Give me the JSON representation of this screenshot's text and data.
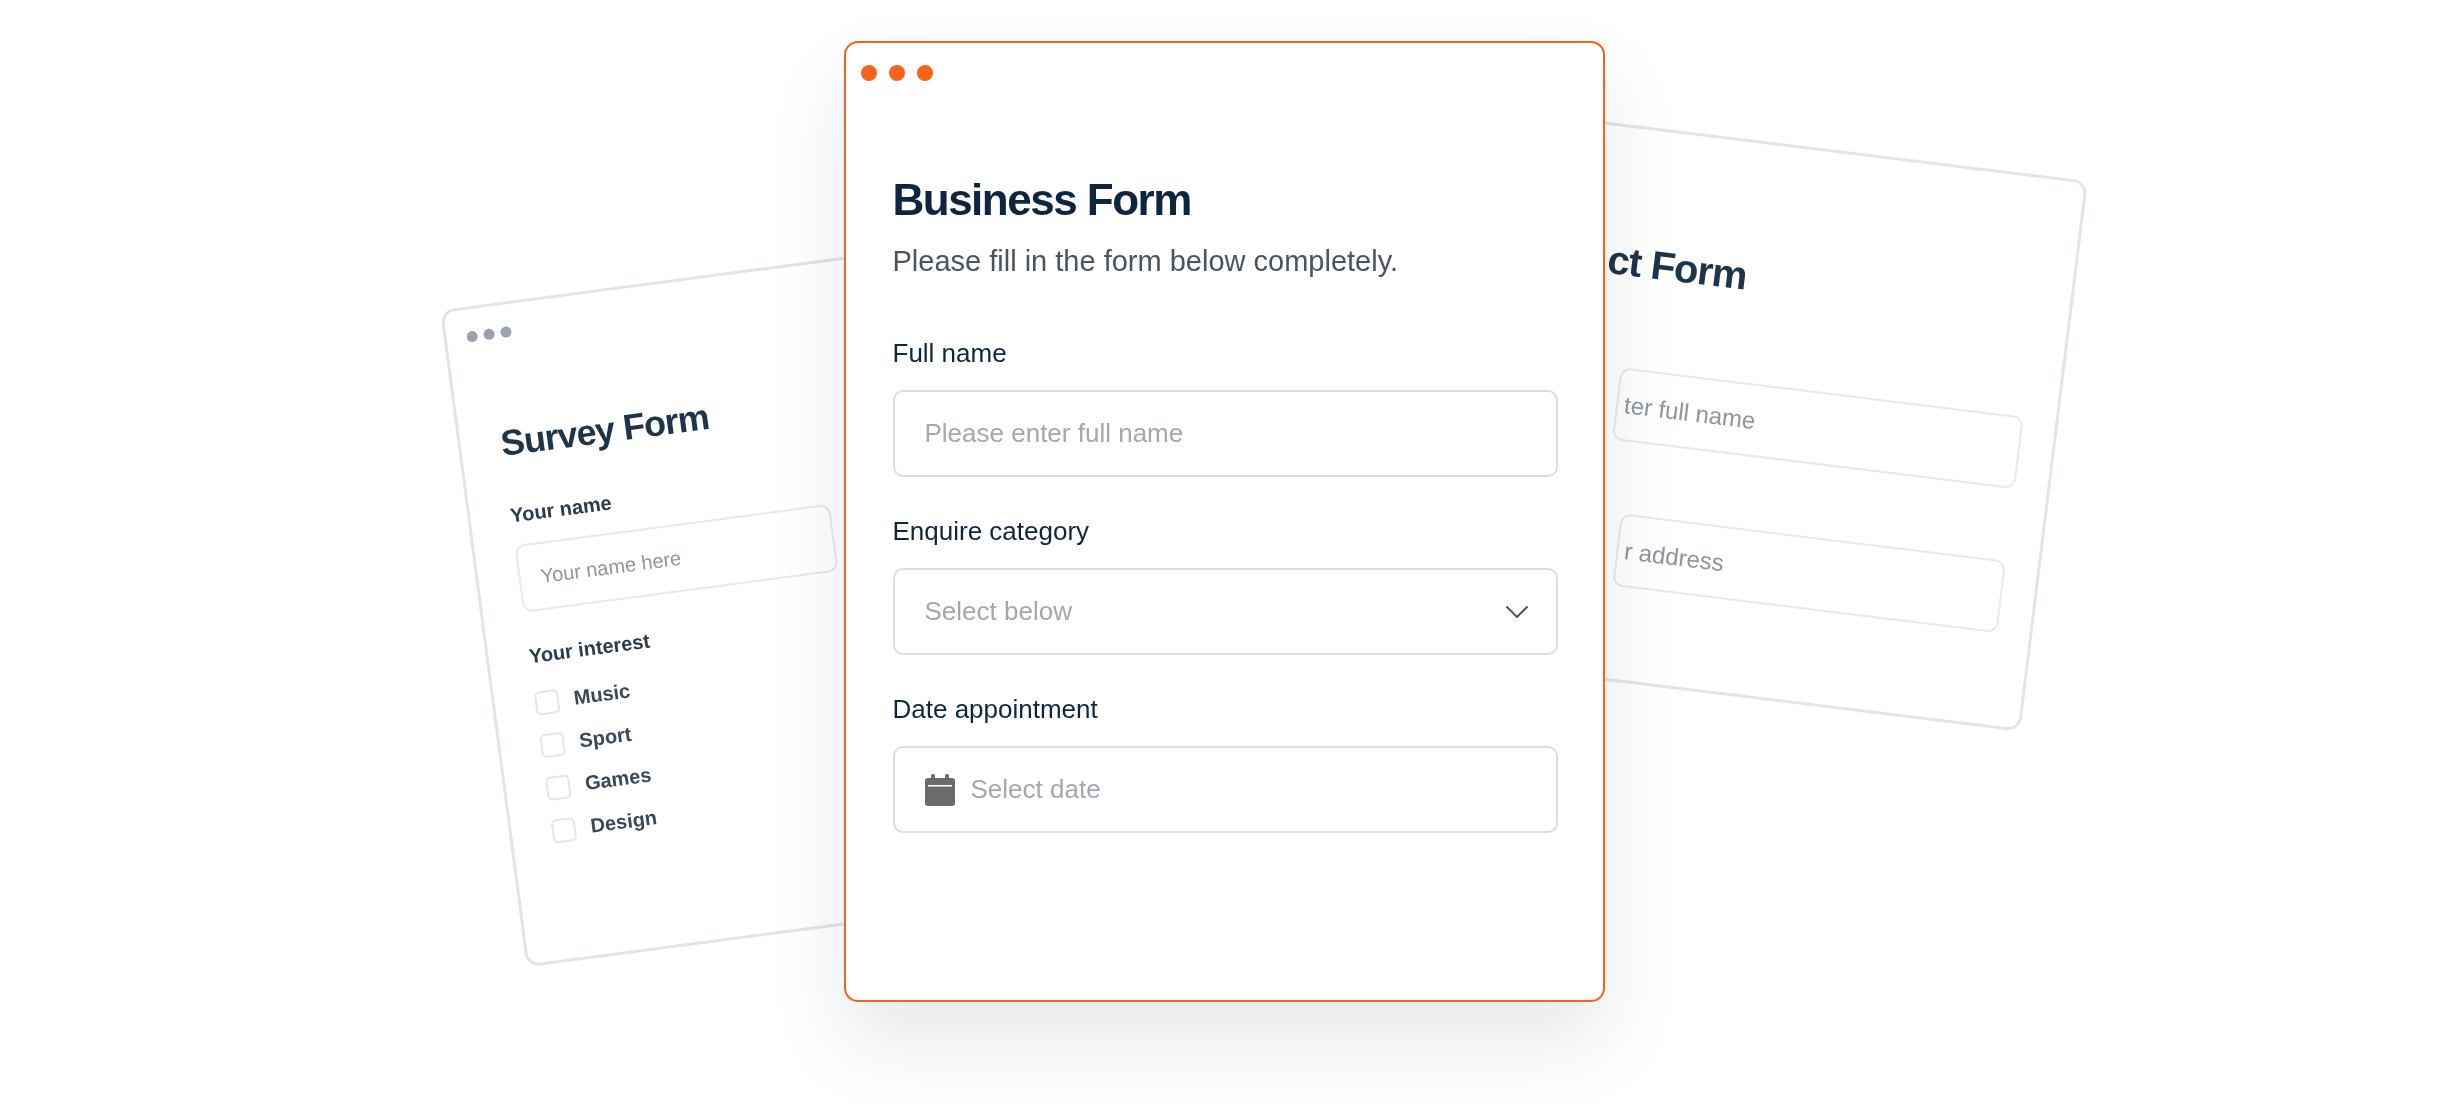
{
  "survey_form": {
    "title": "Survey Form",
    "name_label": "Your name",
    "name_placeholder": "Your name here",
    "interest_label": "Your interest",
    "options": [
      {
        "label": "Music",
        "checked": false
      },
      {
        "label": "Sport",
        "checked": false
      },
      {
        "label": "Games",
        "checked": false
      },
      {
        "label": "Design",
        "checked": false
      }
    ]
  },
  "main_form": {
    "title": "Business Form",
    "subtitle": "Please fill in the form below completely.",
    "fields": [
      {
        "kind": "text",
        "label": "Full name",
        "placeholder": "Please enter full name"
      },
      {
        "kind": "select",
        "label": "Enquire category",
        "placeholder": "Select below"
      },
      {
        "kind": "date",
        "label": "Date appointment",
        "placeholder": "Select date"
      }
    ]
  },
  "contact_form": {
    "title": "ct Form",
    "fields": [
      {
        "placeholder": "ter full name"
      },
      {
        "placeholder": "r address"
      }
    ]
  }
}
